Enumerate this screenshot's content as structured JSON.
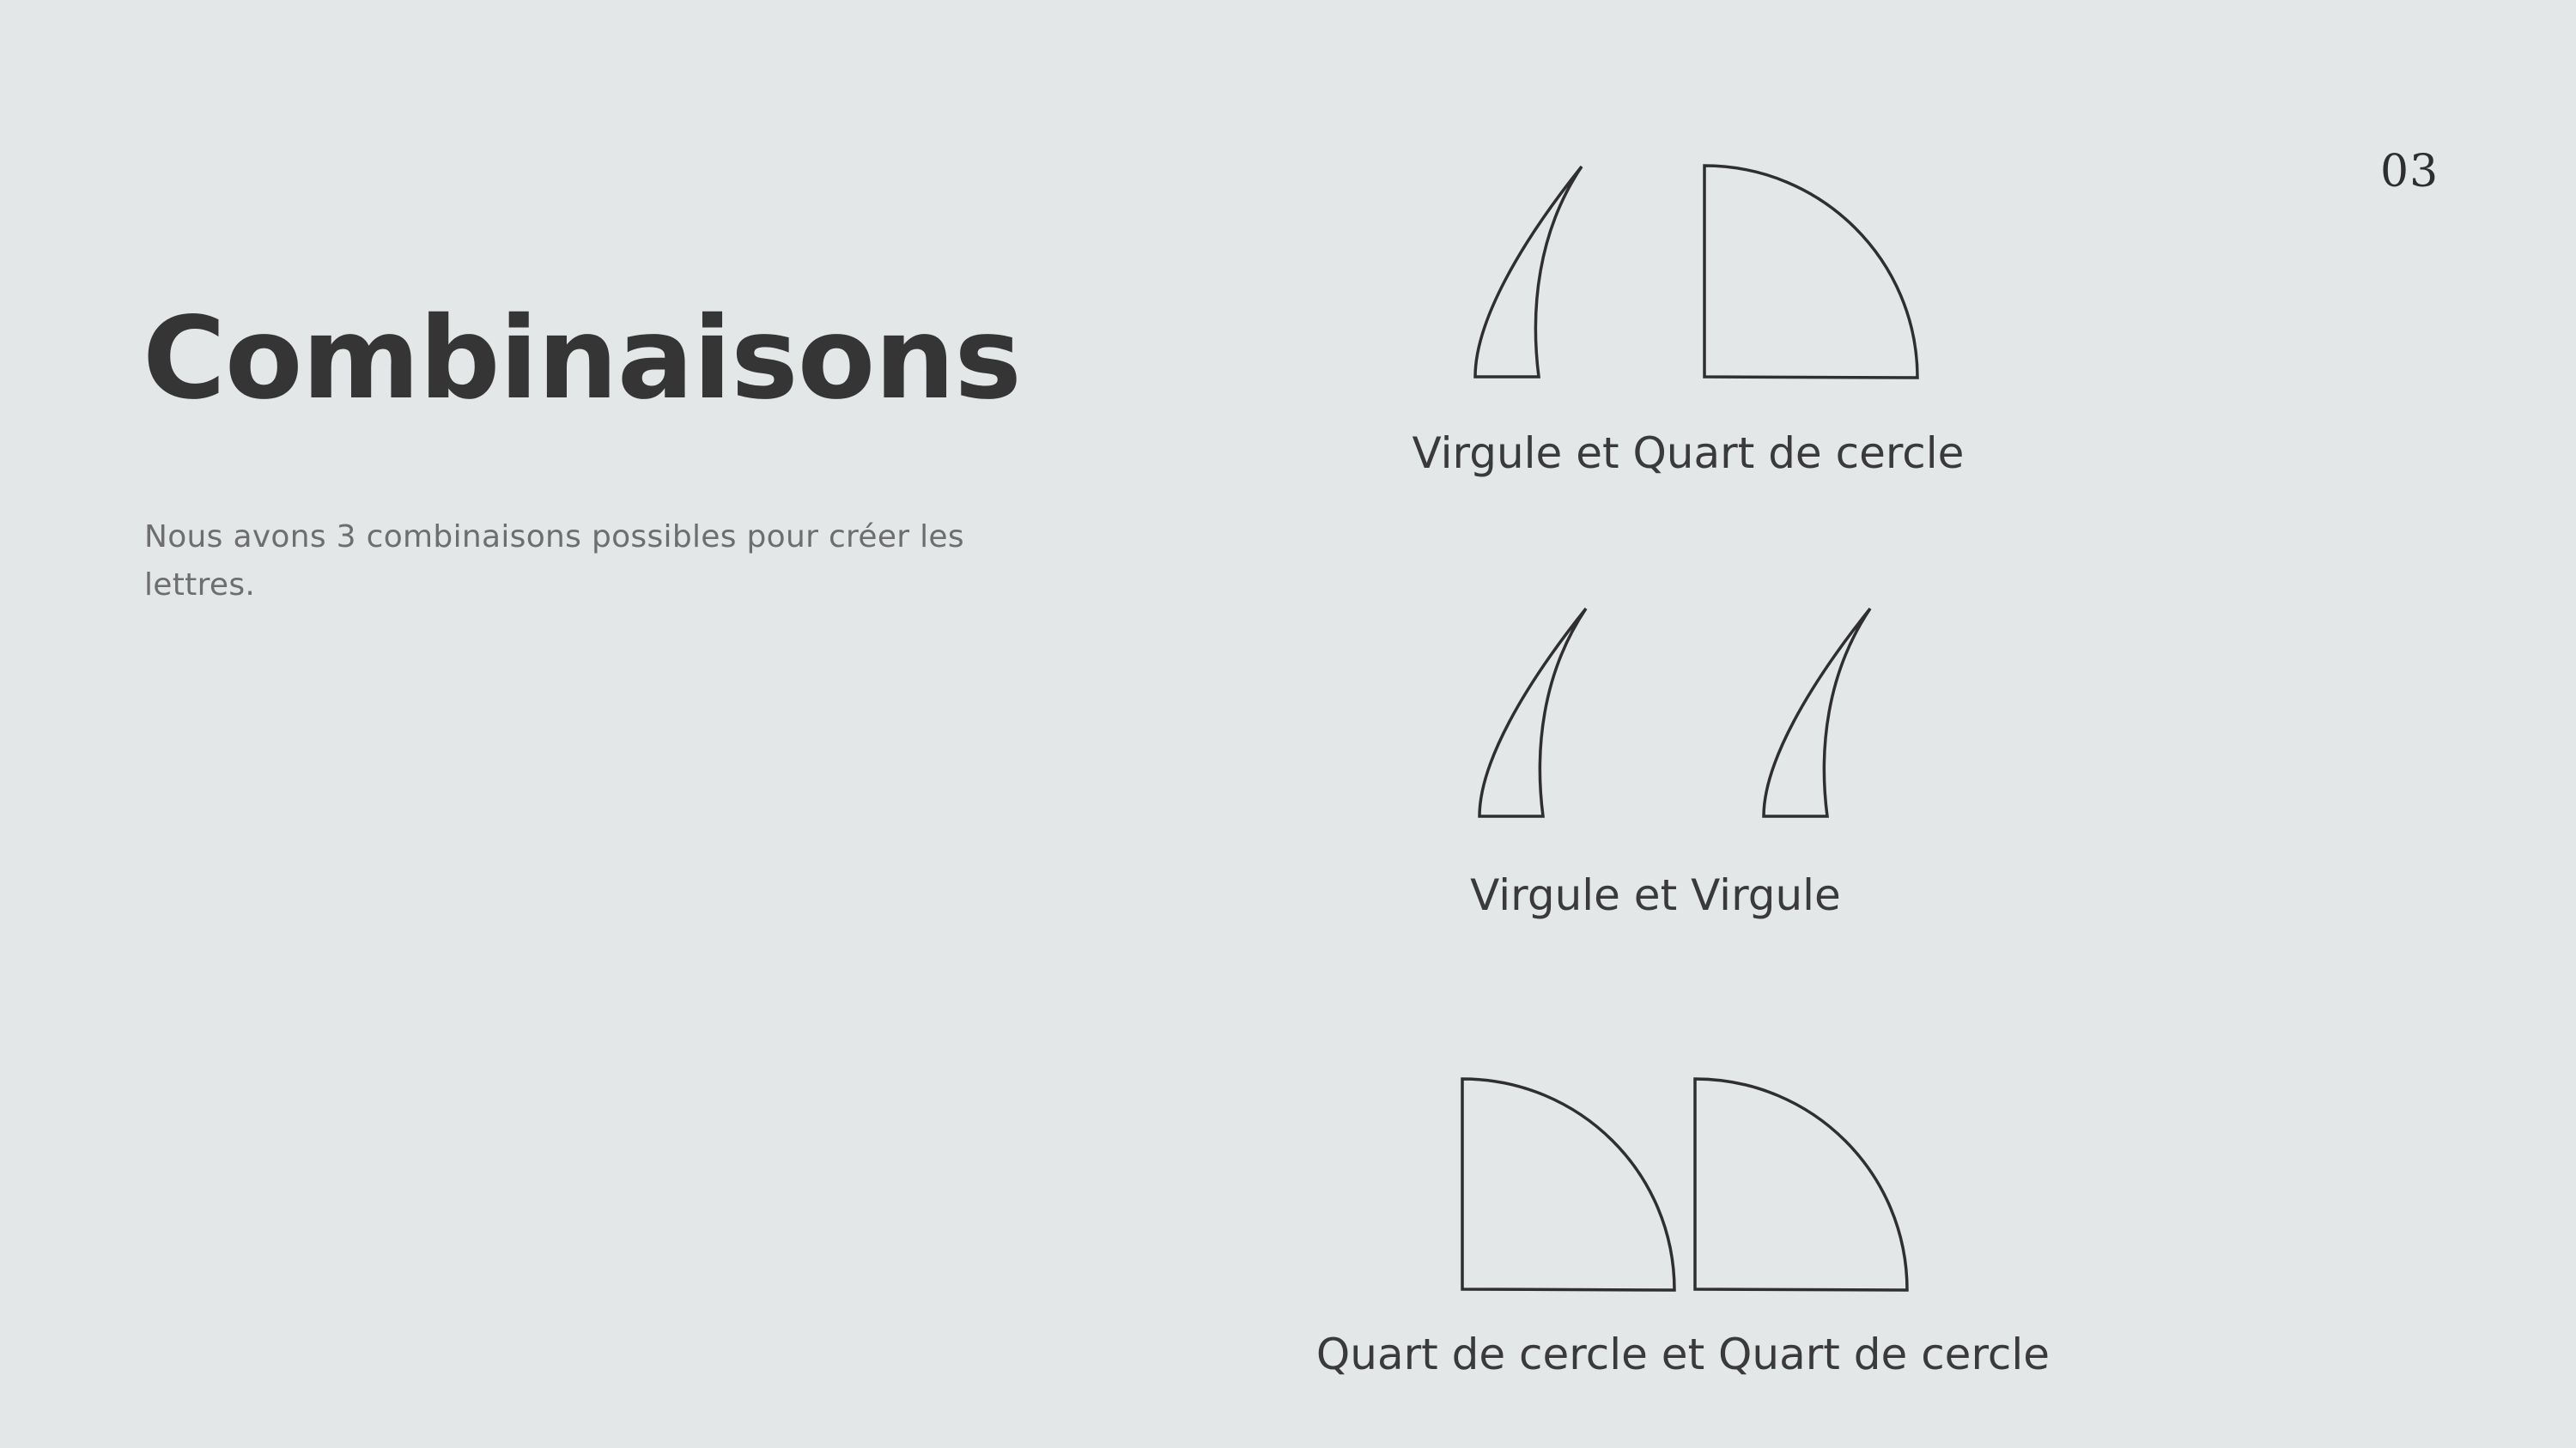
{
  "page_number": "03",
  "title": "Combinaisons",
  "description": "Nous avons 3 combinaisons possibles pour créer les lettres.",
  "combinations": [
    {
      "caption": "Virgule et Quart de cercle",
      "shapes": [
        "comma-shape",
        "quarter-circle-shape"
      ]
    },
    {
      "caption": "Virgule et Virgule",
      "shapes": [
        "comma-shape",
        "comma-shape"
      ]
    },
    {
      "caption": "Quart de cercle et Quart de cercle",
      "shapes": [
        "quarter-circle-shape",
        "quarter-circle-shape"
      ]
    }
  ],
  "colors": {
    "background": "#e3e7e8",
    "title": "#353535",
    "description": "#6e6e6e",
    "stroke": "#2f2f2f"
  }
}
